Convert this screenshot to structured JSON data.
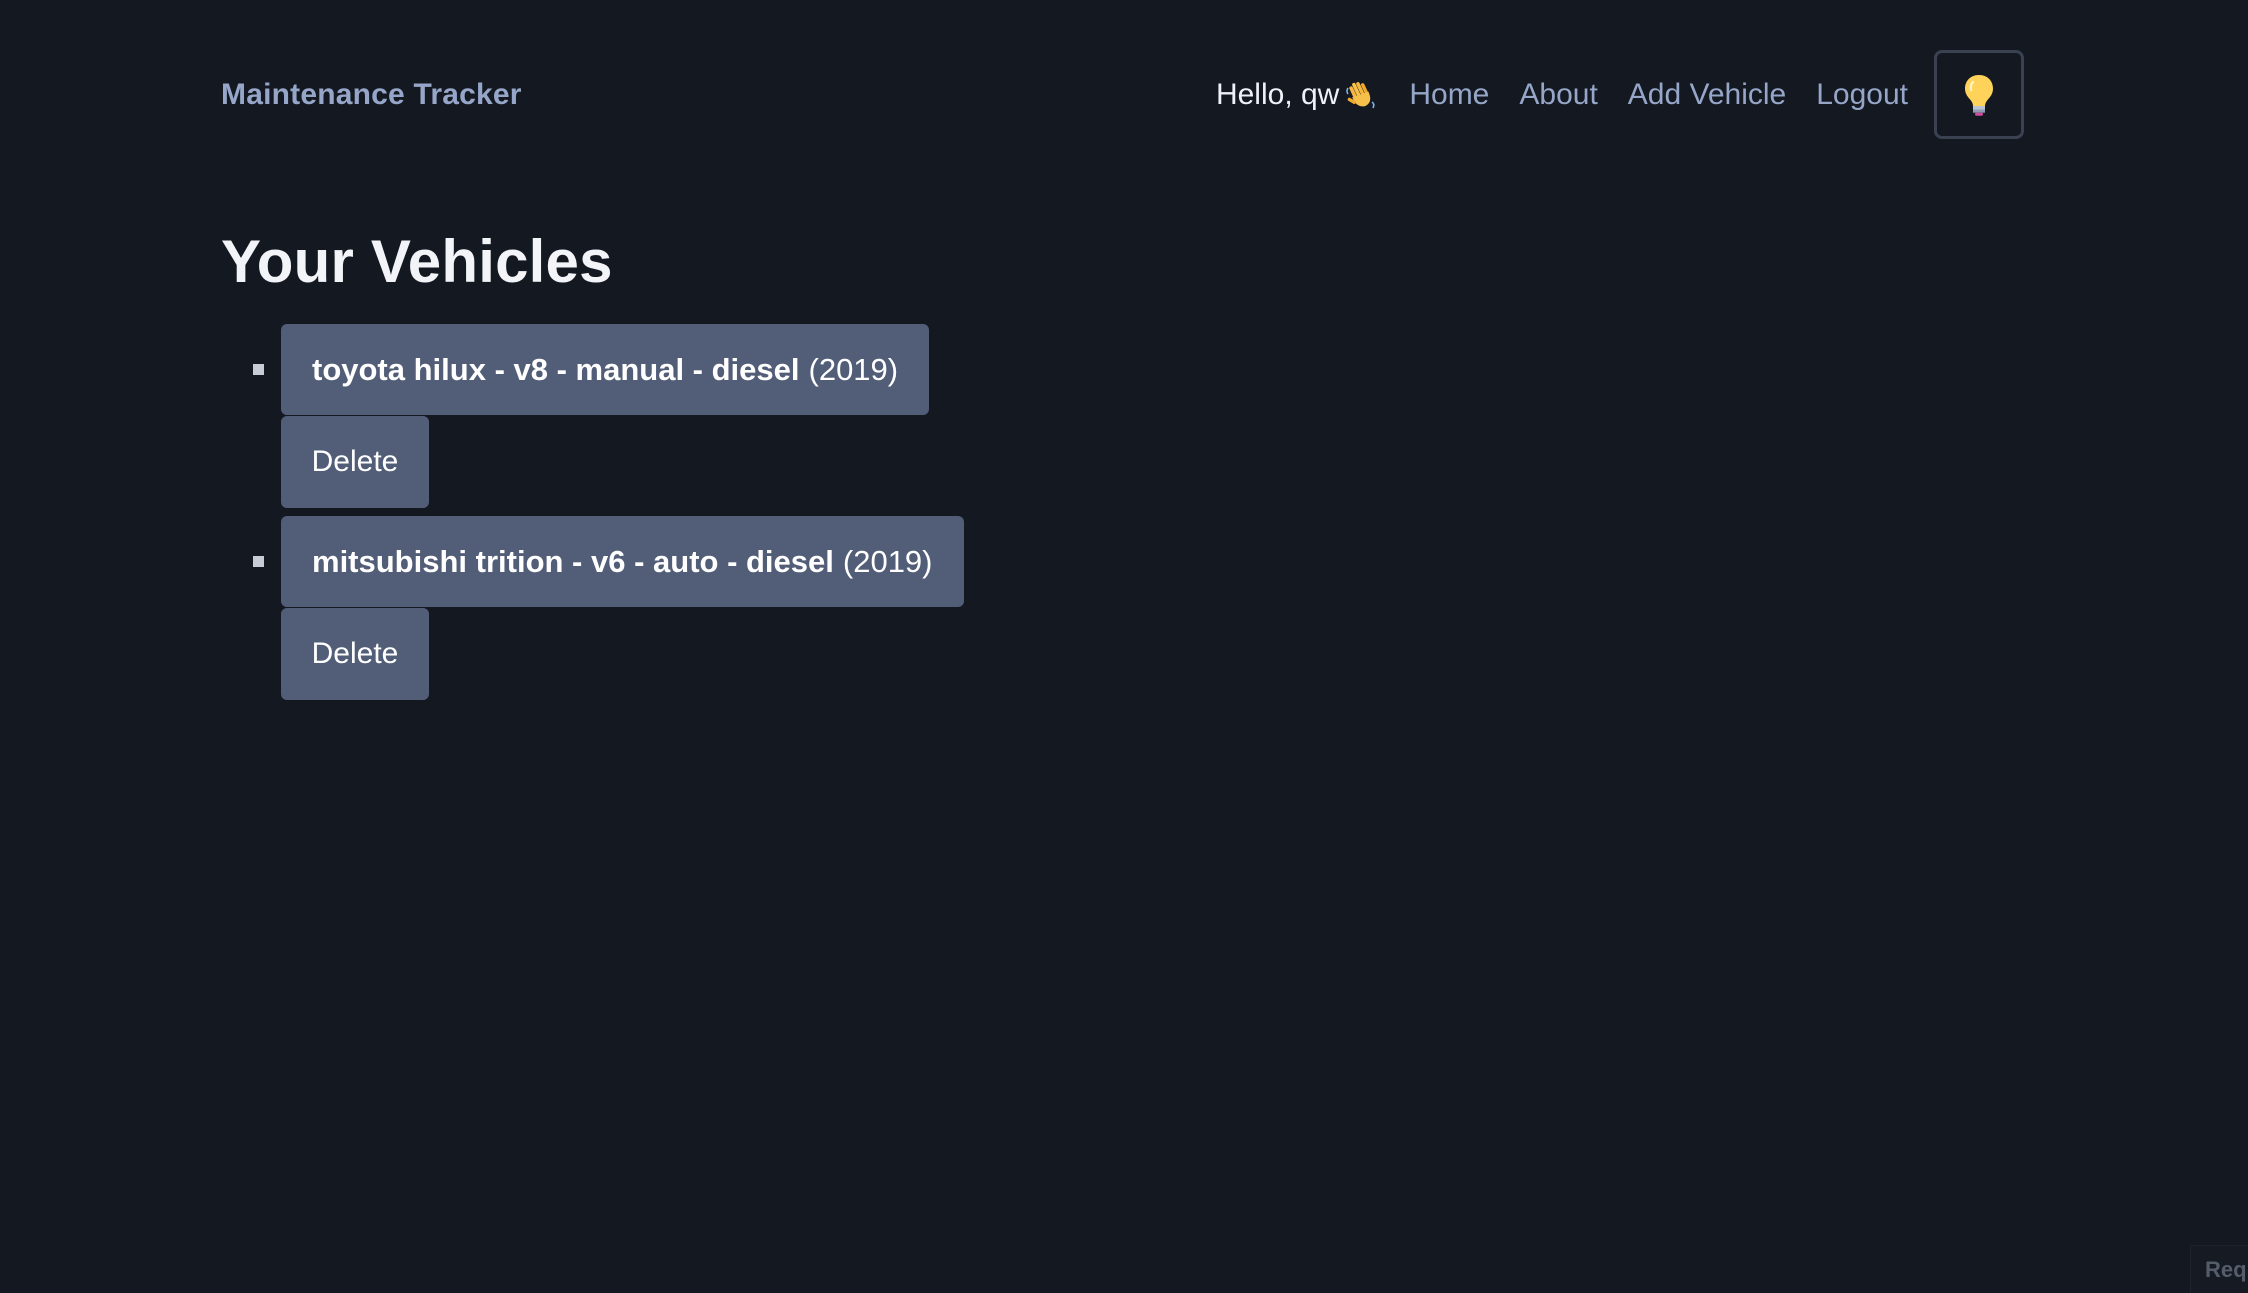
{
  "header": {
    "brand": "Maintenance Tracker",
    "greeting": "Hello, qw",
    "greeting_icon": "waving-hand-icon",
    "nav": {
      "home": "Home",
      "about": "About",
      "add_vehicle": "Add Vehicle",
      "logout": "Logout"
    },
    "theme_toggle_icon": "lightbulb-icon"
  },
  "main": {
    "title": "Your Vehicles",
    "vehicles": [
      {
        "name": "toyota hilux - v8 - manual - diesel",
        "year": "(2019)",
        "delete_label": "Delete"
      },
      {
        "name": "mitsubishi trition - v6 - auto - diesel",
        "year": "(2019)",
        "delete_label": "Delete"
      }
    ]
  },
  "corner_badge": "Req",
  "colors": {
    "background": "#141821",
    "card": "#525e78",
    "link": "#96a6c8",
    "toggle_border": "#3a4252"
  }
}
